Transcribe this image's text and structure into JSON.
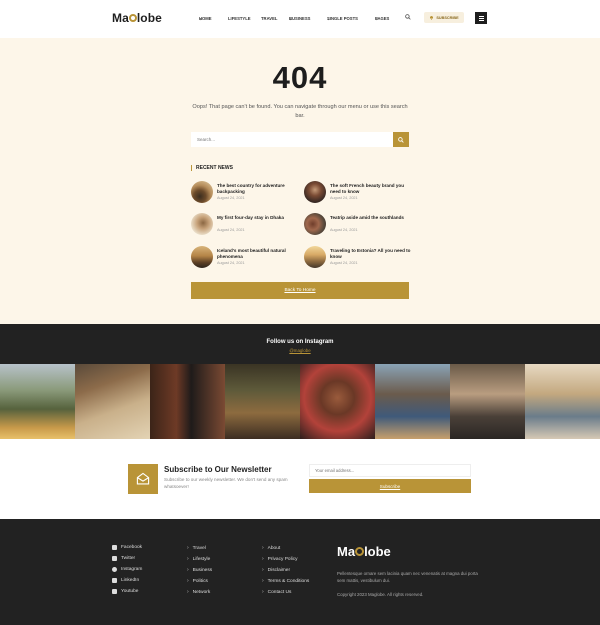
{
  "header": {
    "logo": {
      "pre": "Ma",
      "post": "lobe"
    },
    "nav": [
      {
        "label": "HOME",
        "dropdown": true
      },
      {
        "label": "LIFESTYLE",
        "dropdown": false
      },
      {
        "label": "TRAVEL",
        "dropdown": false
      },
      {
        "label": "BUSINESS",
        "dropdown": true
      },
      {
        "label": "SINGLE POSTS",
        "dropdown": true
      },
      {
        "label": "PAGES",
        "dropdown": true
      }
    ],
    "subscribe_label": "SUBSCRIBE",
    "icons": {
      "search": "search-icon",
      "menu": "hamburger-menu-icon",
      "subscribe": "bell-icon"
    }
  },
  "notfound": {
    "code": "404",
    "message": "Oops! That page can't be found. You can navigate through our menu or use this search bar.",
    "search_placeholder": "Search...",
    "recent_title": "RECENT NEWS",
    "recent": [
      {
        "title": "The best country for adventure backpacking",
        "date": "August 24, 2021"
      },
      {
        "title": "The soft French beauty brand you need to know",
        "date": "August 24, 2021"
      },
      {
        "title": "My first four-day stay in Dhaka",
        "date": "August 24, 2021"
      },
      {
        "title": "Teatrip aside amid the southlands",
        "date": "August 24, 2021"
      },
      {
        "title": "Iceland's most beautiful natural phenomena",
        "date": "August 24, 2021"
      },
      {
        "title": "Traveling to Estonia? All you need to know",
        "date": "August 24, 2021"
      }
    ],
    "back_label": "Back To Home"
  },
  "instagram": {
    "title": "Follow us on Instagram",
    "handle": "@maglobe"
  },
  "newsletter": {
    "title": "Subscribe to Our Newsletter",
    "text": "Subscribe to our weekly newsletter. We don't send any spam whatsoever!",
    "email_placeholder": "Your email address...",
    "button_label": "Subscribe"
  },
  "footer": {
    "social": [
      {
        "label": "Facebook",
        "icon": "facebook-icon"
      },
      {
        "label": "Twitter",
        "icon": "twitter-icon"
      },
      {
        "label": "Instagram",
        "icon": "instagram-icon"
      },
      {
        "label": "LinkedIn",
        "icon": "linkedin-icon"
      },
      {
        "label": "Youtube",
        "icon": "youtube-icon"
      }
    ],
    "categories": [
      "Travel",
      "Lifestyle",
      "Business",
      "Politics",
      "Network"
    ],
    "pages": [
      "About",
      "Privacy Policy",
      "Disclaimer",
      "Terms & Conditions",
      "Contact Us"
    ],
    "logo": {
      "pre": "Ma",
      "post": "lobe"
    },
    "description": "Pellentesque ornare sem lacinia quam nec venenatis at magna dui porta sem mattis, vestibulum dui.",
    "copyright": "Copyright 2023 Maglobe. All rights reserved."
  },
  "colors": {
    "accent": "#b99437",
    "dark": "#222222",
    "cream": "#fdf6e9"
  }
}
